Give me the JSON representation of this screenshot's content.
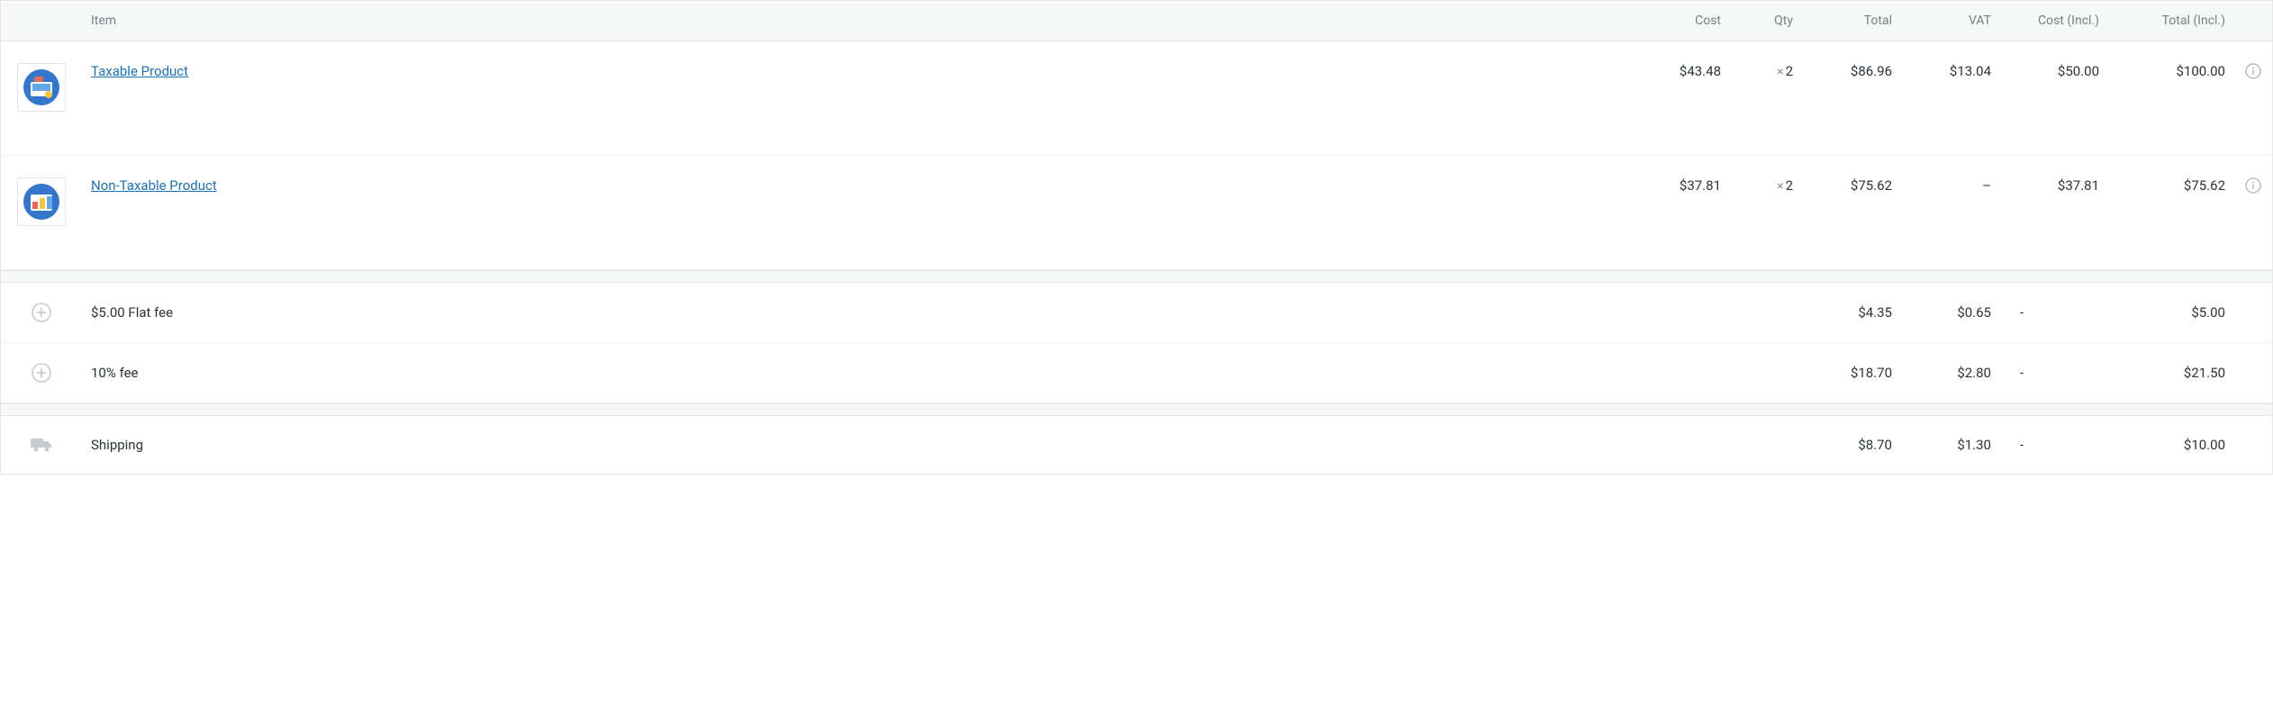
{
  "headers": {
    "item": "Item",
    "cost": "Cost",
    "qty": "Qty",
    "total": "Total",
    "vat": "VAT",
    "cost_incl": "Cost (Incl.)",
    "total_incl": "Total (Incl.)"
  },
  "products": [
    {
      "name": "Taxable Product",
      "cost": "$43.48",
      "qty_prefix": "×",
      "qty": "2",
      "total": "$86.96",
      "vat": "$13.04",
      "cost_incl": "$50.00",
      "total_incl": "$100.00"
    },
    {
      "name": "Non-Taxable Product",
      "cost": "$37.81",
      "qty_prefix": "×",
      "qty": "2",
      "total": "$75.62",
      "vat": "–",
      "cost_incl": "$37.81",
      "total_incl": "$75.62"
    }
  ],
  "fees": [
    {
      "name": "$5.00 Flat fee",
      "total": "$4.35",
      "vat": "$0.65",
      "cost_incl": "-",
      "total_incl": "$5.00"
    },
    {
      "name": "10% fee",
      "total": "$18.70",
      "vat": "$2.80",
      "cost_incl": "-",
      "total_incl": "$21.50"
    }
  ],
  "shipping": {
    "name": "Shipping",
    "total": "$8.70",
    "vat": "$1.30",
    "cost_incl": "-",
    "total_incl": "$10.00"
  }
}
